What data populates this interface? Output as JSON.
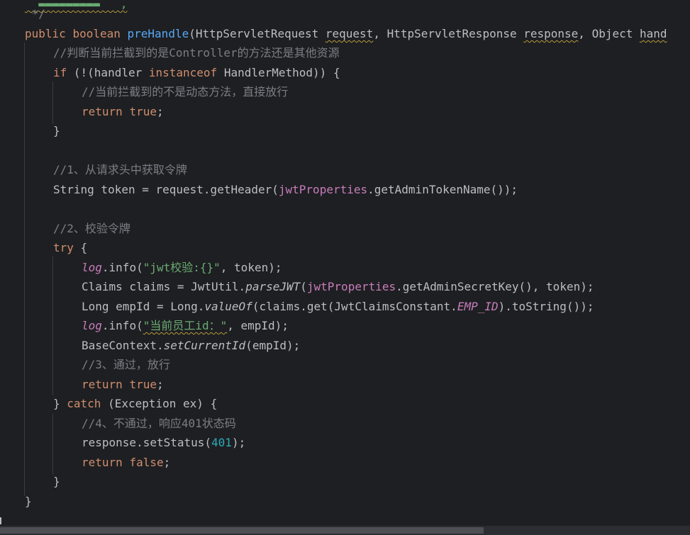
{
  "code": {
    "l0": "  ▬▬▬▬▬▬▬▬▬   ,",
    "l1": " */",
    "l2_kw1": "public",
    "l2_kw2": "boolean",
    "l2_fn": "preHandle",
    "l2_a": "(HttpServletRequest ",
    "l2_b": "request",
    "l2_c": ", HttpServletResponse ",
    "l2_d": "response",
    "l2_e": ", Object ",
    "l2_f": "hand",
    "l3": "//判断当前拦截到的是Controller的方法还是其他资源",
    "l4_kw": "if",
    "l4_a": " (!(handler ",
    "l4_kw2": "instanceof",
    "l4_b": " HandlerMethod)) {",
    "l5": "//当前拦截到的不是动态方法，直接放行",
    "l6_kw": "return",
    "l6_kw2": "true",
    "l6_a": ";",
    "l7": "}",
    "l9": "//1、从请求头中获取令牌",
    "l10_a": "String token = request.getHeader(",
    "l10_fld": "jwtProperties",
    "l10_b": ".getAdminTokenName());",
    "l12": "//2、校验令牌",
    "l13_kw": "try",
    "l13_a": " {",
    "l14_fld": "log",
    "l14_a": ".info(",
    "l14_str": "\"jwt校验:{}\"",
    "l14_b": ", token);",
    "l15_a": "Claims claims = JwtUtil.",
    "l15_it": "parseJWT",
    "l15_b": "(",
    "l15_fld": "jwtProperties",
    "l15_c": ".getAdminSecretKey(), token);",
    "l16_a": "Long empId = Long.",
    "l16_it": "valueOf",
    "l16_b": "(claims.get(JwtClaimsConstant.",
    "l16_fld": "EMP_ID",
    "l16_c": ").toString());",
    "l17_fld": "log",
    "l17_a": ".info(",
    "l17_str": "\"当前员工id：\"",
    "l17_b": ", empId);",
    "l18_a": "BaseContext.",
    "l18_it": "setCurrentId",
    "l18_b": "(empId);",
    "l19": "//3、通过，放行",
    "l20_kw": "return",
    "l20_kw2": "true",
    "l20_a": ";",
    "l21_a": "} ",
    "l21_kw": "catch",
    "l21_b": " (Exception ex) {",
    "l22": "//4、不通过，响应401状态码",
    "l23_a": "response.setStatus(",
    "l23_num": "401",
    "l23_b": ");",
    "l24_kw": "return",
    "l24_kw2": "false",
    "l24_a": ";",
    "l25": "}",
    "l26": "}",
    "l27": "}"
  },
  "colors": {
    "background": "#1e1f22",
    "keyword": "#cf8e6d",
    "function": "#56a8f5",
    "comment": "#7a7e85",
    "field": "#c77dbb",
    "string": "#6aab73",
    "number": "#2aacb8",
    "text": "#bcbec4"
  }
}
